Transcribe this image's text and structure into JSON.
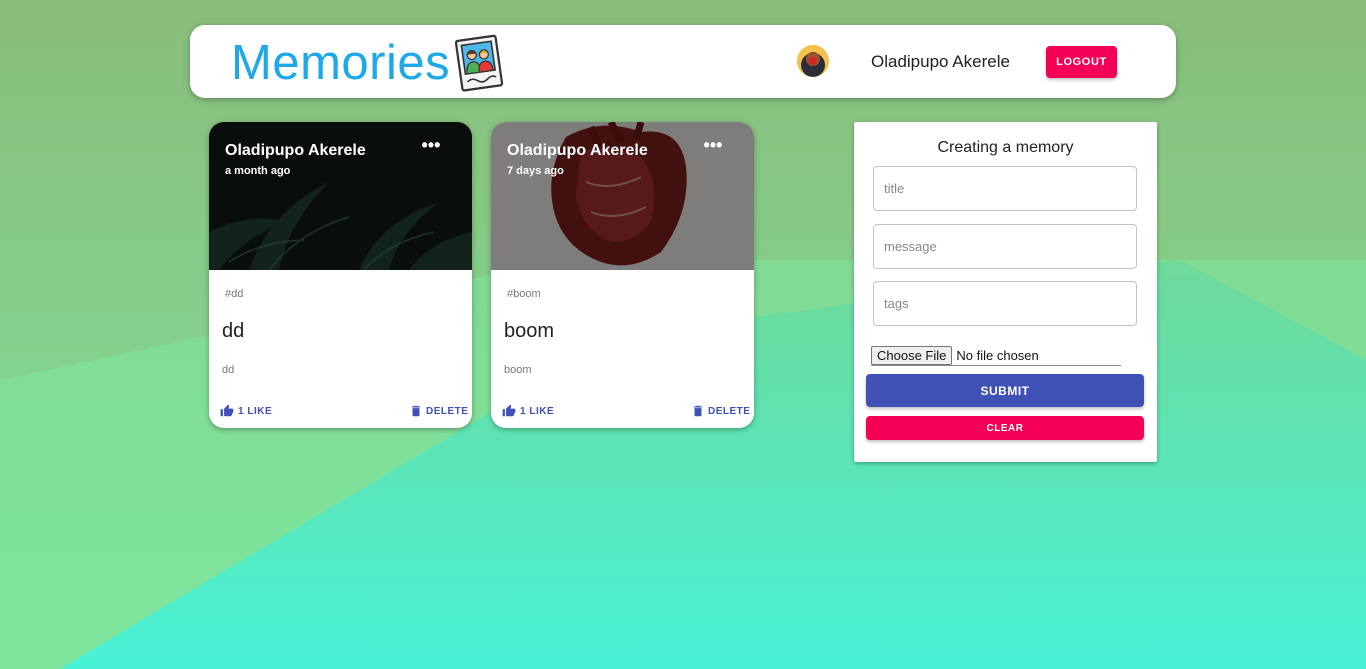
{
  "app": {
    "brand": "Memories",
    "user_name": "Oladipupo Akerele",
    "logout_label": "LOGOUT"
  },
  "posts": [
    {
      "author": "Oladipupo Akerele",
      "time": "a month ago",
      "more": "•••",
      "tags": "#dd",
      "title": "dd",
      "message": "dd",
      "like_label": "1 LIKE",
      "delete_label": "DELETE"
    },
    {
      "author": "Oladipupo Akerele",
      "time": "7 days ago",
      "more": "•••",
      "tags": "#boom",
      "title": "boom",
      "message": "boom",
      "like_label": "1 LIKE",
      "delete_label": "DELETE"
    }
  ],
  "form": {
    "title": "Creating a memory",
    "title_placeholder": "title",
    "message_placeholder": "message",
    "tags_placeholder": "tags",
    "file_button": "Choose File",
    "file_status": "No file chosen",
    "submit_label": "SUBMIT",
    "clear_label": "CLEAR"
  },
  "colors": {
    "brand": "#1ea8e8",
    "primary": "#3f51b5",
    "secondary": "#f50057"
  }
}
